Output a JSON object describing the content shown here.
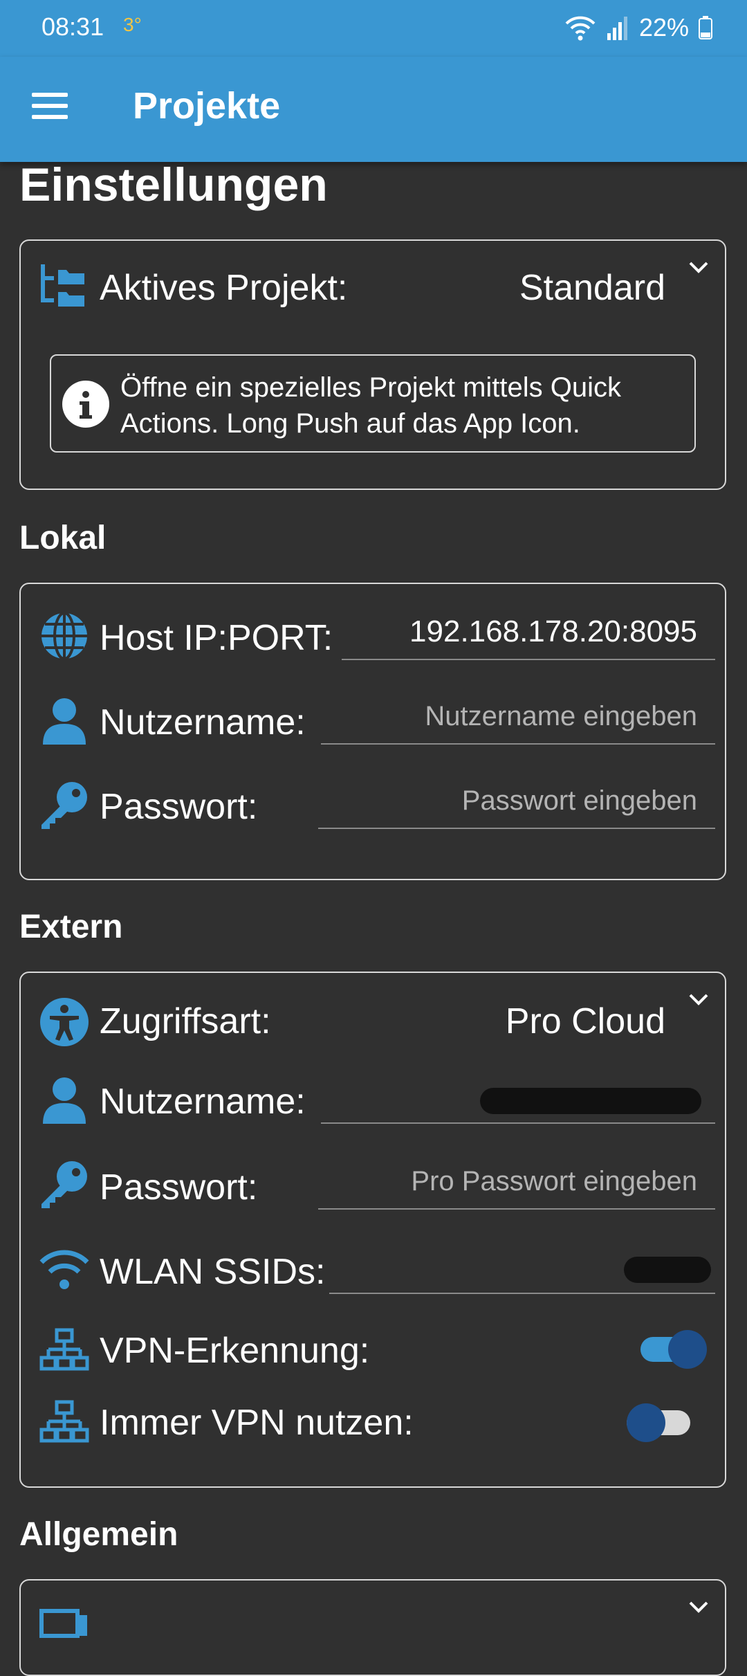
{
  "status": {
    "time": "08:31",
    "temperature": "3°",
    "battery": "22%"
  },
  "app_bar": {
    "title": "Projekte"
  },
  "page": {
    "title": "Einstellungen"
  },
  "project_card": {
    "label": "Aktives Projekt:",
    "value": "Standard",
    "info": "Öffne ein spezielles Projekt mittels Quick Actions. Long Push auf das App Icon."
  },
  "local": {
    "section": "Lokal",
    "host_label": "Host IP:PORT:",
    "host_value": "192.168.178.20:8095",
    "user_label": "Nutzername:",
    "user_placeholder": "Nutzername eingeben",
    "password_label": "Passwort:",
    "password_placeholder": "Passwort eingeben"
  },
  "external": {
    "section": "Extern",
    "access_label": "Zugriffsart:",
    "access_value": "Pro Cloud",
    "user_label": "Nutzername:",
    "password_label": "Passwort:",
    "password_placeholder": "Pro Passwort eingeben",
    "ssid_label": "WLAN SSIDs:",
    "vpn_detect_label": "VPN-Erkennung:",
    "vpn_detect_on": true,
    "vpn_always_label": "Immer VPN nutzen:",
    "vpn_always_on": false
  },
  "general": {
    "section": "Allgemein"
  },
  "colors": {
    "accent": "#3a97d2",
    "background": "#303030",
    "toggle_knob": "#1e4e8a"
  }
}
